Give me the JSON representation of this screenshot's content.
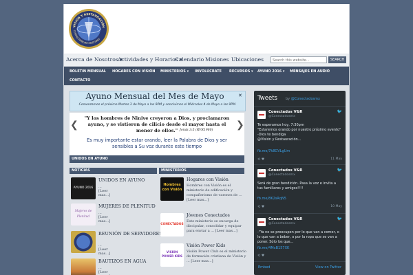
{
  "logo": {
    "top_text": "VISIÓN Y RESTAURACIÓN",
    "bottom_text": "CENTRO FAMILIAR CRISTIANO"
  },
  "nav1": {
    "items": [
      "Acerca de Nosotros ▾",
      "Actividades y Horarios ▾",
      "Calendario",
      "Misiones",
      "Ubicaciones"
    ],
    "search_placeholder": "Search this website...",
    "search_button": "SEARCH"
  },
  "nav2": {
    "items": [
      "BOLETIN MENSUAL",
      "HOGARES CON VISIÓN",
      "MINISTERIOS ▾",
      "INVOLÚCRATE",
      "RECURSOS ▾",
      "AYUNO 2016 ▾",
      "MENSAJES EN AUDIO",
      "CONTACTO"
    ]
  },
  "banner": {
    "title": "Ayuno Mensual del Mes de Mayo",
    "subtitle": "Comenzamos el próximo Martes 3 de Mayo a las 9PM y concluimos el Miércoles 4 de Mayo a las 9PM.",
    "close": "✕"
  },
  "slide": {
    "verse": "\"Y los hombres de Ninive creyeron a Dios, y proclamaron ayuno, y se vistieron de cilicio desde el mayor hasta el menor de ellos.\"",
    "ref": "Jonás 3:5 (RVR1960)",
    "message": "Es muy importante estar orando, leer la Palabra de Dios y ser sensibles a Su voz durante este tiempo",
    "prev": "❮",
    "next": "❯"
  },
  "sections": {
    "featured": "UNIDOS EN AYUNO",
    "news": "NOTICIAS",
    "ministries": "MINISTERIOS"
  },
  "news": [
    {
      "title": "UNIDOS EN AYUNO",
      "more": "... [Leer mas...]",
      "thumb": "AYUNO 2016"
    },
    {
      "title": "MUJERES DE PLENITUD",
      "more": "... [Leer mas...]",
      "thumb": "Mujeres de Plenitud"
    },
    {
      "title": "REUNIÓN DE SERVIDORES",
      "more": "... [Leer mas...]",
      "thumb": ""
    },
    {
      "title": "BAUTIZOS EN AGUA",
      "more": "... [Leer mas...]",
      "thumb": ""
    }
  ],
  "ministries": [
    {
      "title": "Hogares con Visión",
      "desc": "Hombres con Visión es el ministerio de edificación y compañerismo de varones de ... [Leer mas...]",
      "thumb": "Hombres con Visión"
    },
    {
      "title": "Jóvenes Conectados",
      "desc": "Este ministerio se encarga de discipular, consolidar y equipar para enviar a ... [Leer mas...]",
      "thumb": "CONECTADOS"
    },
    {
      "title": "Visión Power Kids",
      "desc": "Visión Power Club es el ministerio de formación cristiana de Visión y ... [Leer mas...]",
      "thumb": "VISION POWER KIDS"
    }
  ],
  "twitter": {
    "title": "Tweets",
    "by_prefix": "by ",
    "by_handle": "@Conectadosmx",
    "embed": "Embed",
    "view": "View on Twitter",
    "tweets": [
      {
        "name": "Conectados V&R",
        "handle": "@Conectadosmx",
        "text": "Te esperamos hoy, 7:30pm\n\"Estaremos orando por nuestro próximo evento\"\n-Dios te bendiga\n@Visión y Restauración...",
        "link": "fb.me/7k8GVLgUm",
        "date": "11 May",
        "actions": "⟲  ♥"
      },
      {
        "name": "Conectados V&R",
        "handle": "@Conectadosmx",
        "text": "Será de gran bendición. Pasa la voz e invita a tus familiares y amigos!!!!",
        "link": "fb.me/8K2sRqN5",
        "date": "10 May",
        "actions": "⟲  ♥"
      },
      {
        "name": "Conectados V&R",
        "handle": "@Conectadosmx",
        "text": "-\"Ya no se preocupen por lo que van a comer, o lo que van a beber, o por la ropa que se van a poner. Sólo los que...",
        "link": "fb.me/4MxB157XK",
        "date": "",
        "actions": "⟲  ♥"
      }
    ]
  }
}
